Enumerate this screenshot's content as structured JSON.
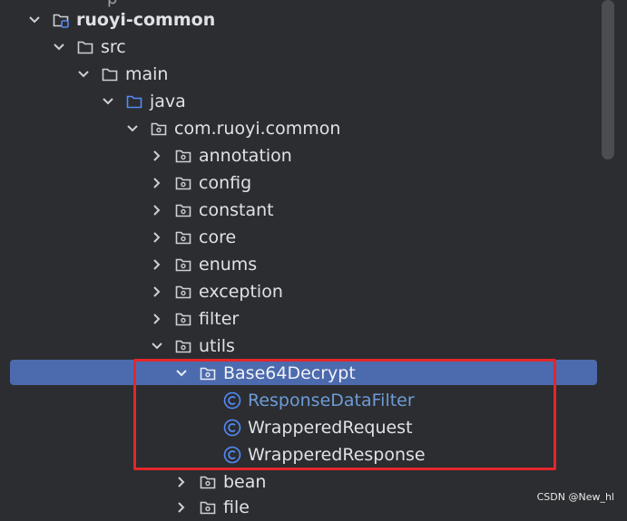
{
  "tree": {
    "top_fragment": "p",
    "rows": [
      {
        "label": "ruoyi-common",
        "state": "expanded",
        "icon": "module-folder-icon"
      },
      {
        "label": "src",
        "state": "expanded",
        "icon": "folder-icon"
      },
      {
        "label": "main",
        "state": "expanded",
        "icon": "folder-icon"
      },
      {
        "label": "java",
        "state": "expanded",
        "icon": "source-folder-icon"
      },
      {
        "label": "com.ruoyi.common",
        "state": "expanded",
        "icon": "package-icon"
      },
      {
        "label": "annotation",
        "state": "collapsed",
        "icon": "package-icon"
      },
      {
        "label": "config",
        "state": "collapsed",
        "icon": "package-icon"
      },
      {
        "label": "constant",
        "state": "collapsed",
        "icon": "package-icon"
      },
      {
        "label": "core",
        "state": "collapsed",
        "icon": "package-icon"
      },
      {
        "label": "enums",
        "state": "collapsed",
        "icon": "package-icon"
      },
      {
        "label": "exception",
        "state": "collapsed",
        "icon": "package-icon"
      },
      {
        "label": "filter",
        "state": "collapsed",
        "icon": "package-icon"
      },
      {
        "label": "utils",
        "state": "expanded",
        "icon": "package-icon"
      },
      {
        "label": "Base64Decrypt",
        "state": "expanded",
        "icon": "package-icon",
        "selected": true
      },
      {
        "label": "ResponseDataFilter",
        "state": "leaf",
        "icon": "class-icon"
      },
      {
        "label": "WrapperedRequest",
        "state": "leaf",
        "icon": "class-icon"
      },
      {
        "label": "WrapperedResponse",
        "state": "leaf",
        "icon": "class-icon"
      },
      {
        "label": "bean",
        "state": "collapsed",
        "icon": "package-icon"
      },
      {
        "label": "file",
        "state": "collapsed",
        "icon": "package-icon"
      }
    ]
  },
  "watermark": "CSDN @New_hl",
  "colors": {
    "background": "#2b2d30",
    "selection": "#4c6aae",
    "highlight_box": "#e3262b",
    "class_icon": "#548af7"
  }
}
